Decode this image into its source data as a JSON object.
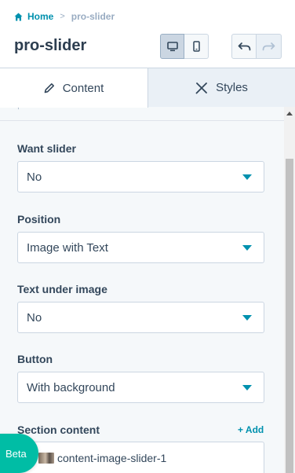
{
  "breadcrumb": {
    "home": "Home",
    "separator": ">",
    "current": "pro-slider"
  },
  "page_title": "pro-slider",
  "toolbar": {
    "devices": [
      {
        "icon": "desktop-icon",
        "active": true
      },
      {
        "icon": "mobile-icon",
        "active": false
      }
    ],
    "history": [
      {
        "icon": "undo-icon",
        "enabled": true
      },
      {
        "icon": "redo-icon",
        "enabled": false
      }
    ]
  },
  "tabs": [
    {
      "label": "Content",
      "icon": "pencil-icon",
      "active": true
    },
    {
      "label": "Styles",
      "icon": "brush-icon",
      "active": false
    }
  ],
  "fields": {
    "want_slider": {
      "label": "Want slider",
      "value": "No"
    },
    "position": {
      "label": "Position",
      "value": "Image with Text"
    },
    "text_under_image": {
      "label": "Text under image",
      "value": "No"
    },
    "button": {
      "label": "Button",
      "value": "With background"
    },
    "section_content": {
      "label": "Section content",
      "add_label": "+ Add",
      "items": [
        "content-image-slider-1"
      ]
    }
  },
  "beta_label": "Beta",
  "colors": {
    "accent": "#0091ae",
    "beta": "#00bda5",
    "panel_bg": "#f5f8fa",
    "text": "#33475b"
  }
}
